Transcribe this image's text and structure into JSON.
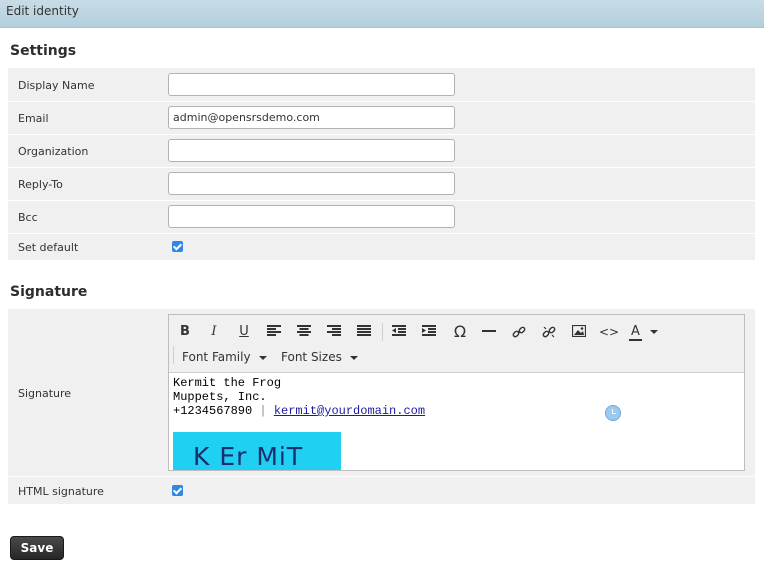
{
  "window": {
    "title": "Edit identity"
  },
  "settings": {
    "heading": "Settings",
    "display_name": {
      "label": "Display Name",
      "value": ""
    },
    "email": {
      "label": "Email",
      "value": "admin@opensrsdemo.com"
    },
    "organization": {
      "label": "Organization",
      "value": ""
    },
    "reply_to": {
      "label": "Reply-To",
      "value": ""
    },
    "bcc": {
      "label": "Bcc",
      "value": ""
    },
    "set_default": {
      "label": "Set default",
      "checked": true
    }
  },
  "signature": {
    "heading": "Signature",
    "label": "Signature",
    "toolbar": {
      "font_family": "Font Family",
      "font_sizes": "Font Sizes",
      "omega": "Ω",
      "text_color": "A",
      "code": "<>"
    },
    "content": {
      "line1": "Kermit the Frog",
      "line2": "Muppets, Inc.",
      "phone": "+1234567890",
      "separator": "|",
      "email_link": "kermit@yourdomain.com",
      "image_text": "K Er MiT"
    },
    "html_signature": {
      "label": "HTML signature",
      "checked": true
    }
  },
  "actions": {
    "save_label": "Save"
  },
  "colors": {
    "checkbox": "#2f87e4",
    "titlebar": "#c1d7e2",
    "row_bg": "#f0f0f0"
  }
}
